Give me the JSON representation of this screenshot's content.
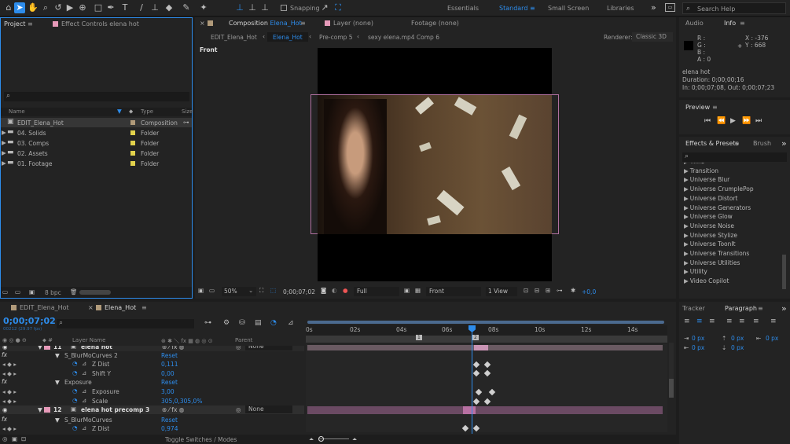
{
  "toolbar": {
    "snapping_label": "Snapping",
    "workspaces": [
      "Essentials",
      "Standard",
      "Small Screen",
      "Libraries"
    ],
    "active_workspace": "Standard",
    "search_placeholder": "Search Help"
  },
  "project": {
    "tab_label": "Project",
    "effect_controls_label": "Effect Controls elena hot",
    "search_placeholder": "",
    "columns": {
      "name": "Name",
      "type": "Type",
      "size": "Size"
    },
    "items": [
      {
        "name": "EDIT_Elena_Hot",
        "type": "Composition",
        "color": "#b09a7a"
      },
      {
        "name": "04. Solids",
        "type": "Folder",
        "color": "#e2d24c"
      },
      {
        "name": "03. Comps",
        "type": "Folder",
        "color": "#e2d24c"
      },
      {
        "name": "02. Assets",
        "type": "Folder",
        "color": "#e2d24c"
      },
      {
        "name": "01. Footage",
        "type": "Folder",
        "color": "#e2d24c"
      }
    ],
    "bpc": "8 bpc"
  },
  "viewer": {
    "comp_tab": "Composition",
    "comp_name": "Elena_Hot",
    "layer_tab": "Layer (none)",
    "footage_tab": "Footage (none)",
    "breadcrumbs": [
      "EDIT_Elena_Hot",
      "Elena_Hot",
      "Pre-comp 5",
      "sexy elena.mp4 Comp 6"
    ],
    "renderer_label": "Renderer:",
    "renderer_value": "Classic 3D",
    "view_label": "Front",
    "zoom": "50%",
    "timecode": "0;00;07;02",
    "resolution": "Full",
    "camera": "Front",
    "views": "1 View",
    "exposure": "+0,0"
  },
  "info": {
    "audio_tab": "Audio",
    "info_tab": "Info",
    "r": "R :",
    "g": "G :",
    "b": "B :",
    "a": "A : 0",
    "x": "X : -376",
    "y": "Y : 668",
    "layer_name": "elena hot",
    "duration": "Duration: 0;00;00;16",
    "inout": "In: 0;00;07;08, Out: 0;00;07;23"
  },
  "preview": {
    "title": "Preview"
  },
  "effects": {
    "tab": "Effects & Presets",
    "brush_tab": "Brush",
    "items": [
      "Time",
      "Transition",
      "Universe Blur",
      "Universe CrumplePop",
      "Universe Distort",
      "Universe Generators",
      "Universe Glow",
      "Universe Noise",
      "Universe Stylize",
      "Universe ToonIt",
      "Universe Transitions",
      "Universe Utilities",
      "Utility",
      "Video Copilot"
    ]
  },
  "tracker": {
    "tracker_tab": "Tracker",
    "paragraph_tab": "Paragraph",
    "values": [
      "0 px",
      "0 px",
      "0 px",
      "0 px",
      "0 px"
    ]
  },
  "timeline": {
    "tabs": [
      "EDIT_Elena_Hot",
      "Elena_Hot"
    ],
    "timecode": "0;00;07;02",
    "frames": "00212 (29.97 fps)",
    "col_layer": "Layer Name",
    "col_parent": "Parent",
    "ruler": [
      "0s",
      "02s",
      "04s",
      "06s",
      "08s",
      "10s",
      "12s",
      "14s"
    ],
    "marker1": "1",
    "marker2": "2",
    "toggle_label": "Toggle Switches / Modes",
    "rows": [
      {
        "name": "elena hot",
        "num": "11",
        "kind": "layer",
        "parent": "None"
      },
      {
        "name": "S_BlurMoCurves 2",
        "kind": "effect",
        "value": "Reset"
      },
      {
        "name": "Z Dist",
        "kind": "prop",
        "value": "0,111"
      },
      {
        "name": "Shift Y",
        "kind": "prop",
        "value": "0,00"
      },
      {
        "name": "Exposure",
        "kind": "effect",
        "value": "Reset"
      },
      {
        "name": "Exposure",
        "kind": "prop",
        "value": "3,00"
      },
      {
        "name": "Scale",
        "kind": "prop",
        "value": "305,0,305,0%"
      },
      {
        "name": "elena hot precomp 3",
        "num": "12",
        "kind": "layer",
        "parent": "None"
      },
      {
        "name": "S_BlurMoCurves",
        "kind": "effect",
        "value": "Reset"
      },
      {
        "name": "Z Dist",
        "kind": "prop",
        "value": "0,974"
      }
    ]
  }
}
